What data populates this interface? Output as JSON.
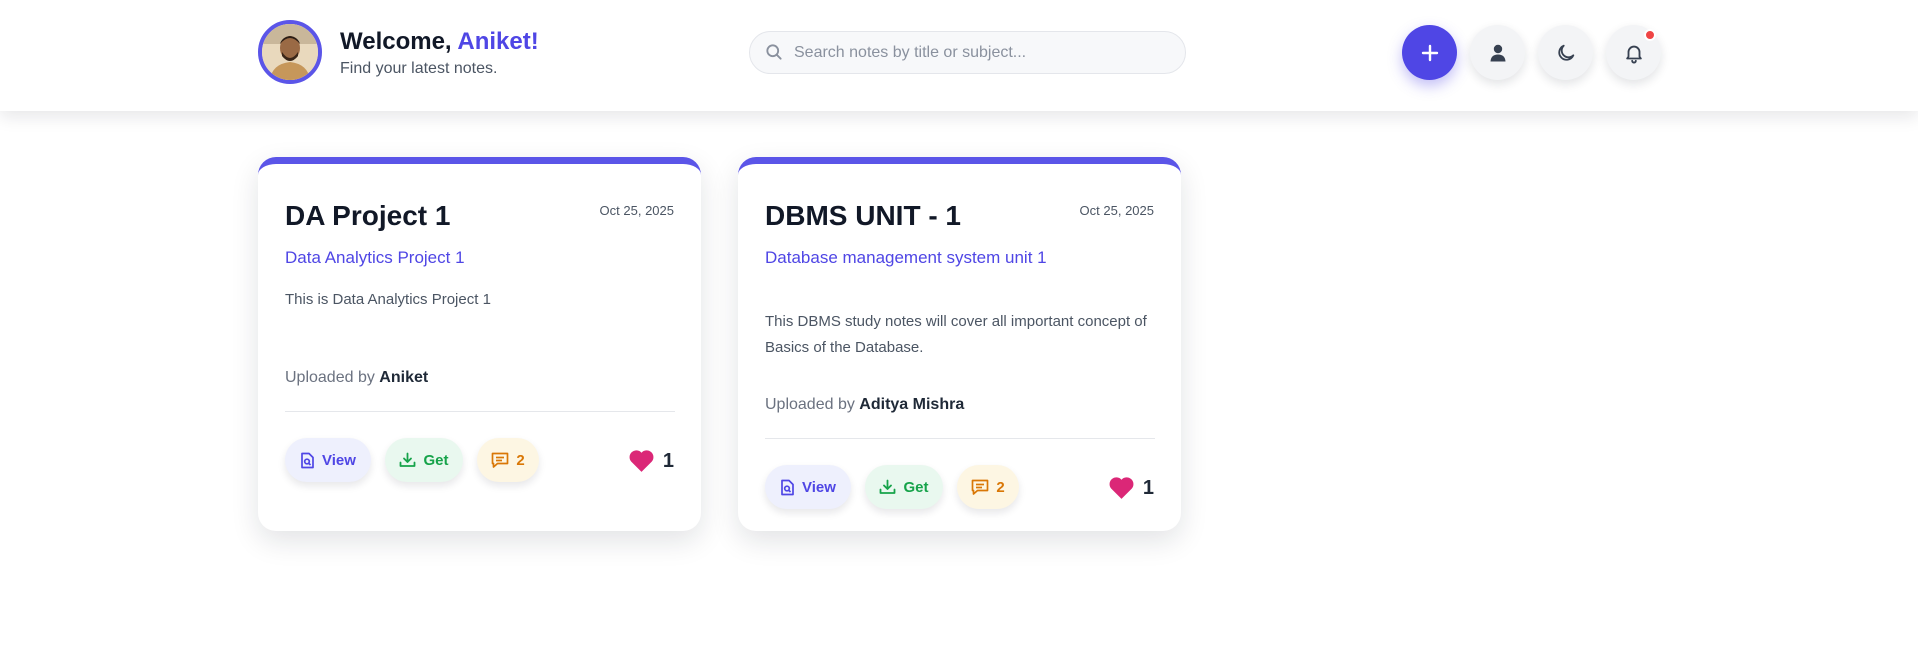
{
  "header": {
    "welcome_prefix": "Welcome, ",
    "user_name": "Aniket!",
    "subtitle": "Find your latest notes.",
    "search_placeholder": "Search notes by title or subject...",
    "buttons": {
      "add_icon": "plus-icon",
      "profile_icon": "user-icon",
      "theme_icon": "moon-icon",
      "notifications_icon": "bell-icon"
    },
    "has_notification": true
  },
  "notes": [
    {
      "title": "DA Project 1",
      "date": "Oct 25, 2025",
      "subject": "Data Analytics Project 1",
      "description": "This is Data Analytics Project 1",
      "uploaded_prefix": "Uploaded by ",
      "uploader": "Aniket",
      "view_label": "View",
      "get_label": "Get",
      "comments": "2",
      "likes": "1"
    },
    {
      "title": "DBMS UNIT - 1",
      "date": "Oct 25, 2025",
      "subject": "Database management system unit 1",
      "description": "This DBMS study notes will cover all important concept of Basics of the Database.",
      "uploaded_prefix": "Uploaded by ",
      "uploader": "Aditya Mishra",
      "view_label": "View",
      "get_label": "Get",
      "comments": "2",
      "likes": "1"
    }
  ],
  "colors": {
    "accent": "#4f46e5",
    "card_top_border": "#5b55e8",
    "view_bg": "#eef0fd",
    "get_color": "#16a34a",
    "comment_color": "#d97706",
    "like_color": "#db2777",
    "notification_dot": "#ef4444"
  }
}
